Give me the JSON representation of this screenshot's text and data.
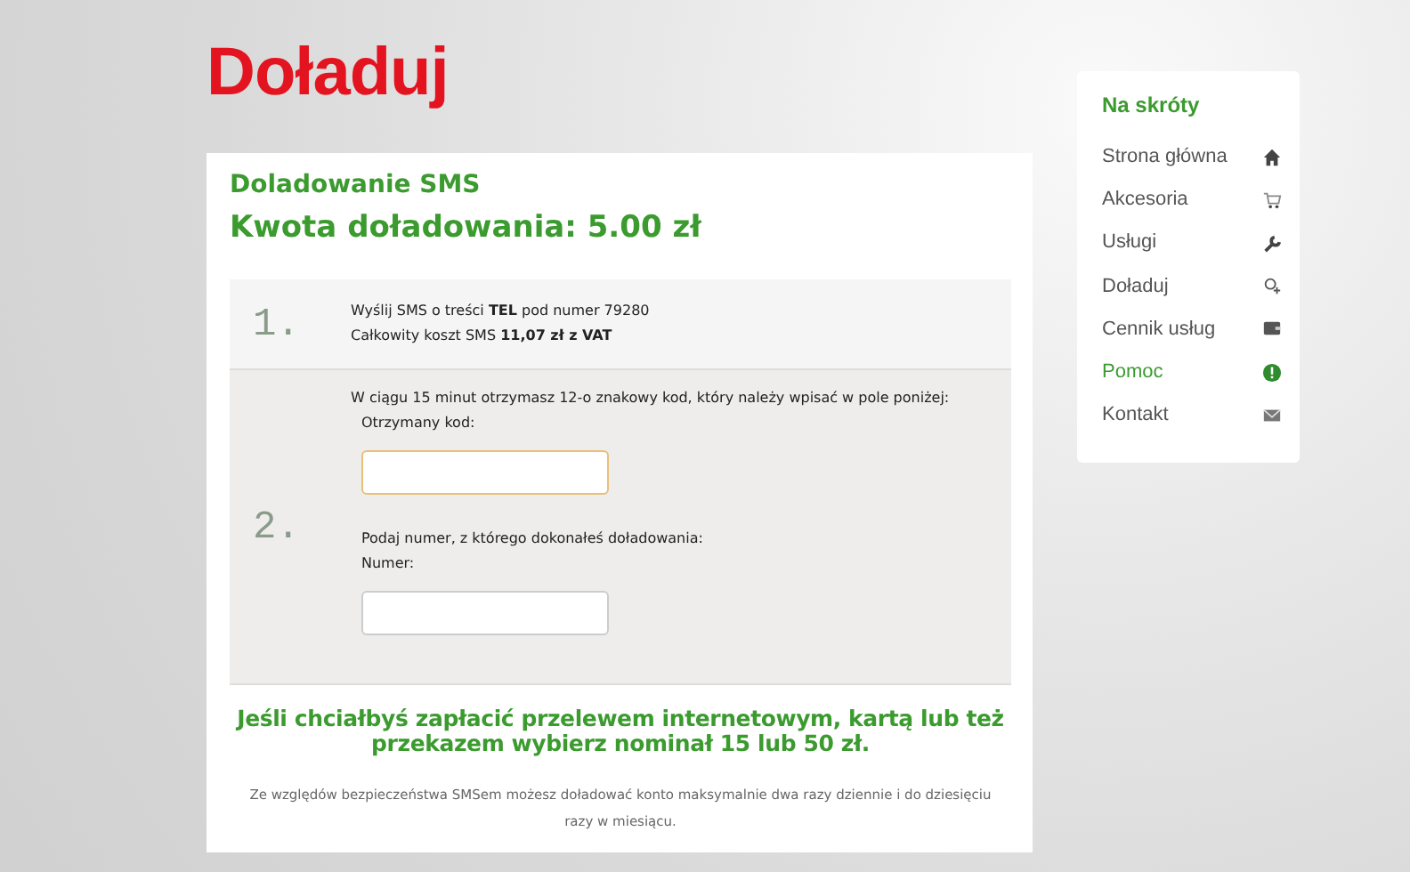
{
  "page_title": "Doładuj",
  "card": {
    "title": "Doladowanie SMS",
    "amount": "Kwota doładowania: 5.00 zł",
    "steps": [
      {
        "number": "1.",
        "lines": [
          "Wyślij SMS o treści **TEL** pod numer 79280",
          "Całkowity koszt SMS **11,07 zł z VAT**"
        ]
      },
      {
        "number": "2.",
        "lines": [
          "W ciągu 15 minut otrzymasz 12-o znakowy kod, który należy wpisać w pole poniżej:"
        ],
        "fields": [
          {
            "label": "Otrzymany kod:",
            "focused": true
          },
          {
            "hint": "Podaj numer, z którego dokonałeś doładowania:",
            "label": "Numer:",
            "focused": false
          }
        ]
      }
    ],
    "promo": "Jeśli chciałbyś zapłacić przelewem internetowym, kartą lub też przekazem wybierz nominał 15 lub 50 zł.",
    "note": "Ze względów bezpieczeństwa SMSem możesz doładować konto maksymalnie dwa razy dziennie i do dziesięciu razy w miesiącu."
  },
  "sidebar": {
    "title": "Na skróty",
    "items": [
      {
        "label": "Strona główna",
        "kind": "home",
        "selected": false
      },
      {
        "label": "Akcesoria",
        "kind": "cart",
        "selected": false
      },
      {
        "label": "Usługi",
        "kind": "wrench",
        "selected": false
      },
      {
        "label": "Doładuj",
        "kind": "topup",
        "selected": false
      },
      {
        "label": "Cennik usług",
        "kind": "wallet",
        "selected": false
      },
      {
        "label": "Pomoc",
        "kind": "help",
        "selected": true
      },
      {
        "label": "Kontakt",
        "kind": "mail",
        "selected": false
      }
    ]
  }
}
